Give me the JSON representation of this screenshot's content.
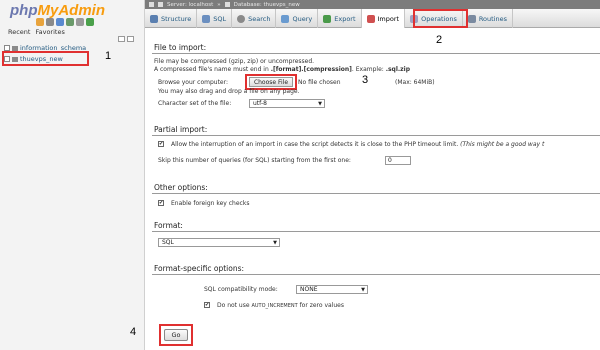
{
  "sidebar": {
    "logo_php": "php",
    "logo_myadmin": "MyAdmin",
    "tab_recent": "Recent",
    "tab_favorites": "Favorites",
    "databases": [
      {
        "name": "information_schema"
      },
      {
        "name": "thuevps_new"
      }
    ]
  },
  "breadcrumb": {
    "server": "Server: localhost",
    "database": "Database: thuevps_new"
  },
  "menu": {
    "tabs": [
      {
        "label": "Structure",
        "color": "#5a7fb0"
      },
      {
        "label": "SQL",
        "color": "#6b8fc0"
      },
      {
        "label": "Search",
        "color": "#8a8a8a"
      },
      {
        "label": "Query",
        "color": "#6a9bd0"
      },
      {
        "label": "Export",
        "color": "#4a9a4a"
      },
      {
        "label": "Import",
        "color": "#d05050",
        "active": true
      },
      {
        "label": "Operations",
        "color": "#a0a0c0"
      },
      {
        "label": "Routines",
        "color": "#7a8aa0"
      }
    ]
  },
  "callouts": {
    "one": "1",
    "two": "2",
    "three": "3",
    "four": "4"
  },
  "file_import": {
    "heading": "File to import:",
    "line1": "File may be compressed (gzip, zip) or uncompressed.",
    "line2_pre": "A compressed file's name must end in ",
    "line2_bold": ".[format].[compression]",
    "line2_post": ". Example: ",
    "line2_example": ".sql.zip",
    "browse_label": "Browse your computer:",
    "choose_file": "Choose File",
    "no_file": "No file chosen",
    "max": "(Max: 64MiB)",
    "drag_note": "You may also drag and drop a file on any page.",
    "charset_label": "Character set of the file:",
    "charset_value": "utf-8"
  },
  "partial_import": {
    "heading": "Partial import:",
    "allow_pre": "Allow the interruption of an import in case the script detects it is close to the PHP timeout limit. ",
    "allow_italic": "(This might be a good way t",
    "skip_label": "Skip this number of queries (for SQL) starting from the first one:",
    "skip_value": "0"
  },
  "other_options": {
    "heading": "Other options:",
    "foreign_keys": "Enable foreign key checks"
  },
  "format": {
    "heading": "Format:",
    "value": "SQL"
  },
  "format_specific": {
    "heading": "Format-specific options:",
    "compat_label": "SQL compatibility mode:",
    "compat_value": "NONE",
    "auto_inc_pre": "Do not use ",
    "auto_inc_code": "AUTO_INCREMENT",
    "auto_inc_post": " for zero values"
  },
  "go_label": "Go"
}
